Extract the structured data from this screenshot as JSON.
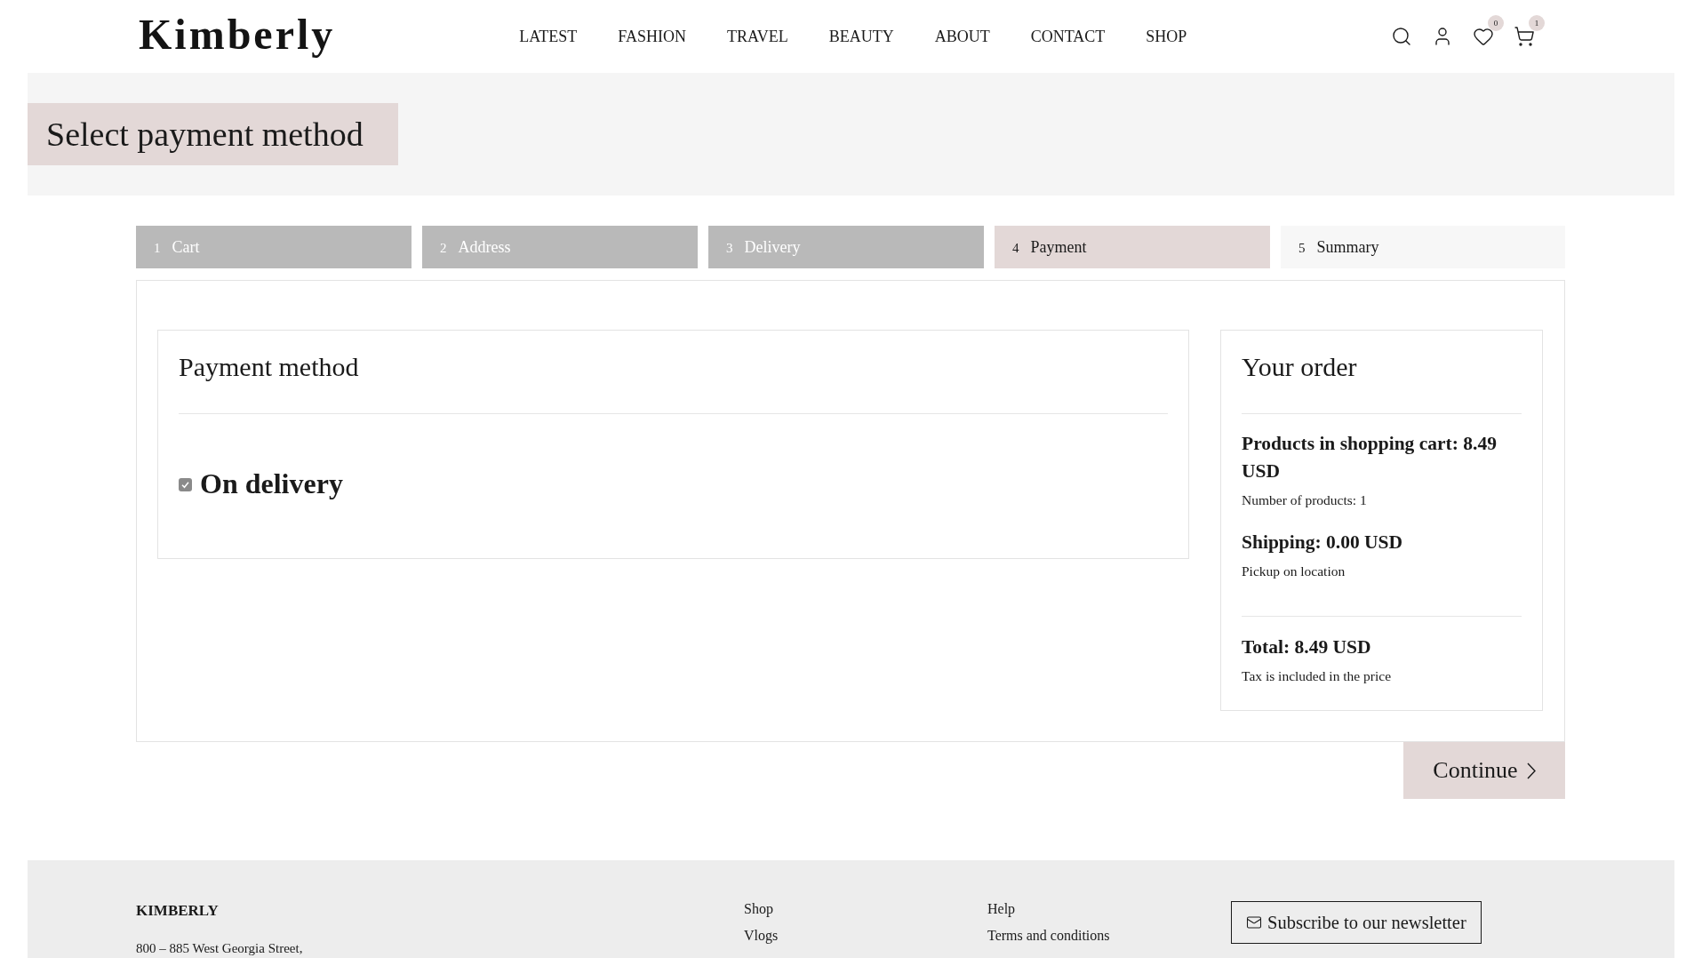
{
  "header": {
    "logo": "Kimberly",
    "nav": [
      {
        "label": "LATEST"
      },
      {
        "label": "FASHION"
      },
      {
        "label": "TRAVEL"
      },
      {
        "label": "BEAUTY"
      },
      {
        "label": "ABOUT"
      },
      {
        "label": "CONTACT"
      },
      {
        "label": "SHOP"
      }
    ],
    "wishlist_count": "0",
    "cart_count": "1"
  },
  "banner": {
    "title": "Select payment method"
  },
  "steps": [
    {
      "number": "1",
      "label": "Cart",
      "completed": true,
      "selected": false
    },
    {
      "number": "2",
      "label": "Address",
      "completed": true,
      "selected": false
    },
    {
      "number": "3",
      "label": "Delivery",
      "completed": true,
      "selected": false
    },
    {
      "number": "4",
      "label": "Payment",
      "completed": false,
      "selected": true
    },
    {
      "number": "5",
      "label": "Summary",
      "completed": false,
      "selected": false
    }
  ],
  "payment": {
    "title": "Payment method",
    "options": [
      {
        "label": "On delivery",
        "checked": true
      }
    ]
  },
  "order": {
    "title": "Your order",
    "lines": [
      {
        "heading": "Products in shopping cart: 8.49 USD",
        "note": "Number of products: 1"
      },
      {
        "heading": "Shipping: 0.00 USD",
        "note": "Pickup on location"
      }
    ],
    "total": {
      "heading": "Total: 8.49 USD",
      "note": "Tax is included in the price"
    }
  },
  "continue_button": "Continue",
  "footer": {
    "brand": "KIMBERLY",
    "address": "800 – 885 West Georgia Street,",
    "columns": [
      {
        "links": [
          "Shop",
          "Vlogs"
        ]
      },
      {
        "links": [
          "Help",
          "Terms and conditions"
        ]
      }
    ],
    "newsletter_button": "Subscribe to our newsletter"
  }
}
